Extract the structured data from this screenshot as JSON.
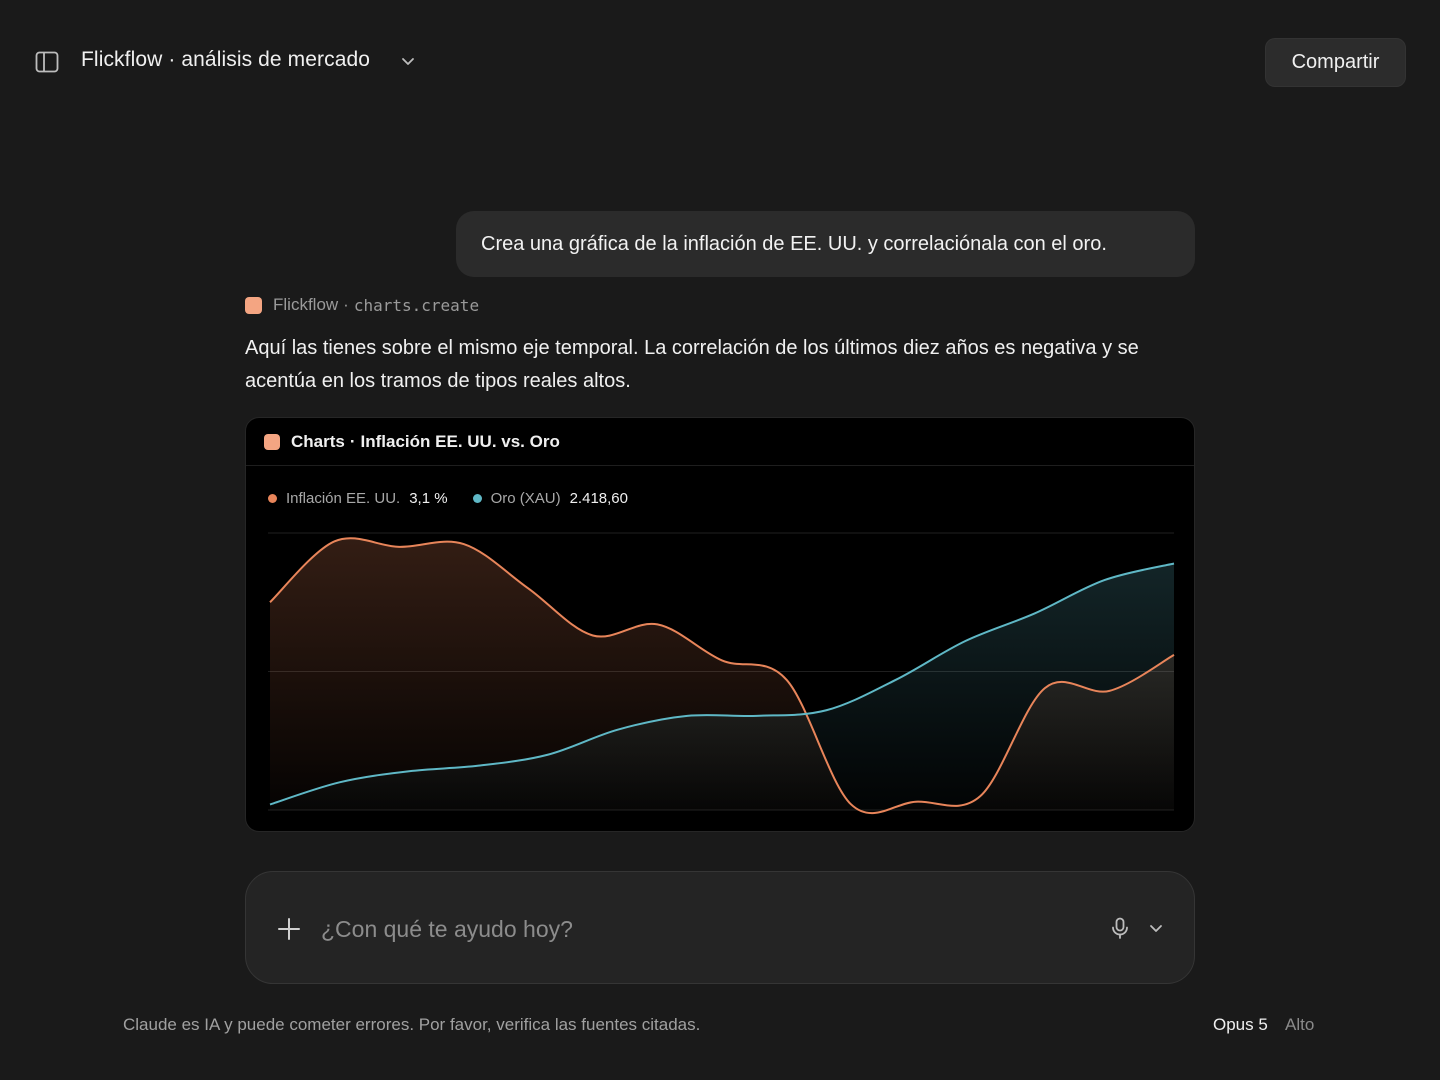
{
  "header": {
    "title": "Flickflow · análisis de mercado",
    "share_label": "Compartir",
    "sidebar_icon": "sidebar-toggle-icon",
    "title_dropdown_icon": "chevron-down-icon"
  },
  "conversation": {
    "user_message": "Crea una gráfica de la inflación de EE. UU. y correlaciónala con el oro.",
    "tool_call": {
      "app": "Flickflow",
      "separator": "·",
      "function": "charts.create",
      "badge_color": "#f4a582"
    },
    "assistant_message": "Aquí las tienes sobre el mismo eje temporal. La correlación de los últimos diez años es negativa y se acentúa en los tramos de tipos reales altos."
  },
  "chart_card": {
    "app": "Charts",
    "separator": "·",
    "title": "Inflación EE. UU. vs. Oro",
    "badge_color": "#f4a582"
  },
  "chart_data": {
    "type": "area",
    "title": "Inflación EE. UU. vs. Oro",
    "grid": true,
    "legend_placement": "top-left",
    "series": [
      {
        "name": "Inflación EE. UU.",
        "current_value_label": "3,1 %",
        "color": "#e8855a",
        "values": [
          0.75,
          0.97,
          0.95,
          0.96,
          0.8,
          0.63,
          0.67,
          0.54,
          0.47,
          0.02,
          0.03,
          0.05,
          0.44,
          0.43,
          0.56
        ]
      },
      {
        "name": "Oro (XAU)",
        "current_value_label": "2.418,60",
        "color": "#5fb8c6",
        "values": [
          0.02,
          0.1,
          0.14,
          0.16,
          0.2,
          0.29,
          0.34,
          0.34,
          0.36,
          0.47,
          0.61,
          0.71,
          0.83,
          0.89
        ]
      }
    ],
    "x_range": [
      0,
      14
    ],
    "y_range": [
      0,
      1
    ],
    "gridlines": [
      0,
      0.5,
      1
    ]
  },
  "composer": {
    "placeholder": "¿Con qué te ayudo hoy?",
    "plus_icon": "plus-icon",
    "mic_icon": "microphone-icon",
    "options_icon": "chevron-down-icon"
  },
  "footer": {
    "disclaimer": "Claude es IA y puede cometer errores. Por favor, verifica las fuentes citadas.",
    "model": "Opus 5",
    "effort": "Alto"
  },
  "colors": {
    "background": "#1a1a1a",
    "surface": "#2b2b2b",
    "chart_background": "#000000",
    "accent": "#f4a582"
  }
}
